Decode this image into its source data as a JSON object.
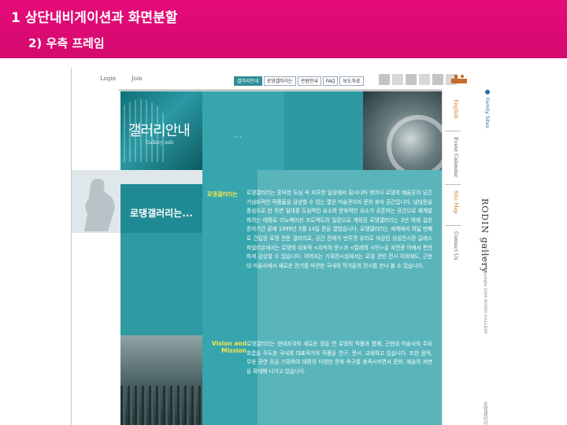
{
  "slide": {
    "title": "1 상단내비게이션과 화면분할",
    "subtitle": "2) 우측 프레임"
  },
  "site": {
    "auth": {
      "login": "Login",
      "join": "Join"
    },
    "nav": {
      "items": [
        "갤러리안내",
        "로댕갤러리는",
        "관람안내",
        "FAQ",
        "보도자료"
      ]
    },
    "gallery_title": "갤러리안내",
    "gallery_sub": "Gallery info",
    "band_label": "로댕갤러리는...",
    "dots": "···",
    "section1_heading": "로댕갤러리는",
    "section1_text": "로댕갤러리는 혼탁한 도심 속 지루한 일상에서 잠시나마 벗어나 로댕의 예술혼이 담긴 기념비적인 작품들을 감상할 수 있는 열린 미술관이자 문화 휴식 공간입니다. 남대문을 중심으로 한 주변 일대를 도심적인 요소와 문화적인 요소가 공존하는 공간으로 재개발하려는 태평로 리노베이션 프로젝트의 일환으로 계획된 로댕갤러리는 3년 여에 걸친 준비기간 끝에 1999년 5월 14일 문을 열었습니다. 로댕갤러리는 세계에서 여덟 번째로 건립된 로댕 전문 갤러리로, 공간 전체가 반투명 유리로 마감된 상설전시장 글래스 파빌리온에서는 로댕의 대표작 <지옥의 문>과 <칼레의 시민>을 자연광 아래서 편안하게 감상할 수 있습니다. 이어지는 기획전시실에서는 로댕 관련 전시 이외에도, 근현대 미술사에서 새로운 전기를 마련한 국내외 작가들의 전시를 만나 볼 수 있습니다.",
    "section2_heading": "Vision and Mission",
    "section2_text": "로댕갤러리는 현대조각의 새로운 장을 연 로댕의 작품과 함께, 근현대 미술사의 주요 흐름을 주도한 국내외 대표작가의 작품을 연구, 전시, 교육하고 있습니다. 또한 음악, 무용 공연 등을 기획하여 대중의 다양한 문화 욕구를 충족시키면서 문화, 예술의 저변을 확대해 나가고 있습니다.",
    "vnav": [
      "English",
      "Event Calendar",
      "Site Map",
      "Contact Us"
    ],
    "family_sites": "Family Sites",
    "brand": "RODIN gallery",
    "copyright": "All Contents Copyright 2006 RODIN GALLERY",
    "corner": "로댕갤러리"
  },
  "colors": {
    "slide_bar": "#e50b79",
    "teal_dark": "#1f8a93",
    "teal": "#37a5ad",
    "teal_light": "#5ab5bb",
    "heading_yellow": "#f5e64c",
    "accent_orange": "#d4721a"
  }
}
